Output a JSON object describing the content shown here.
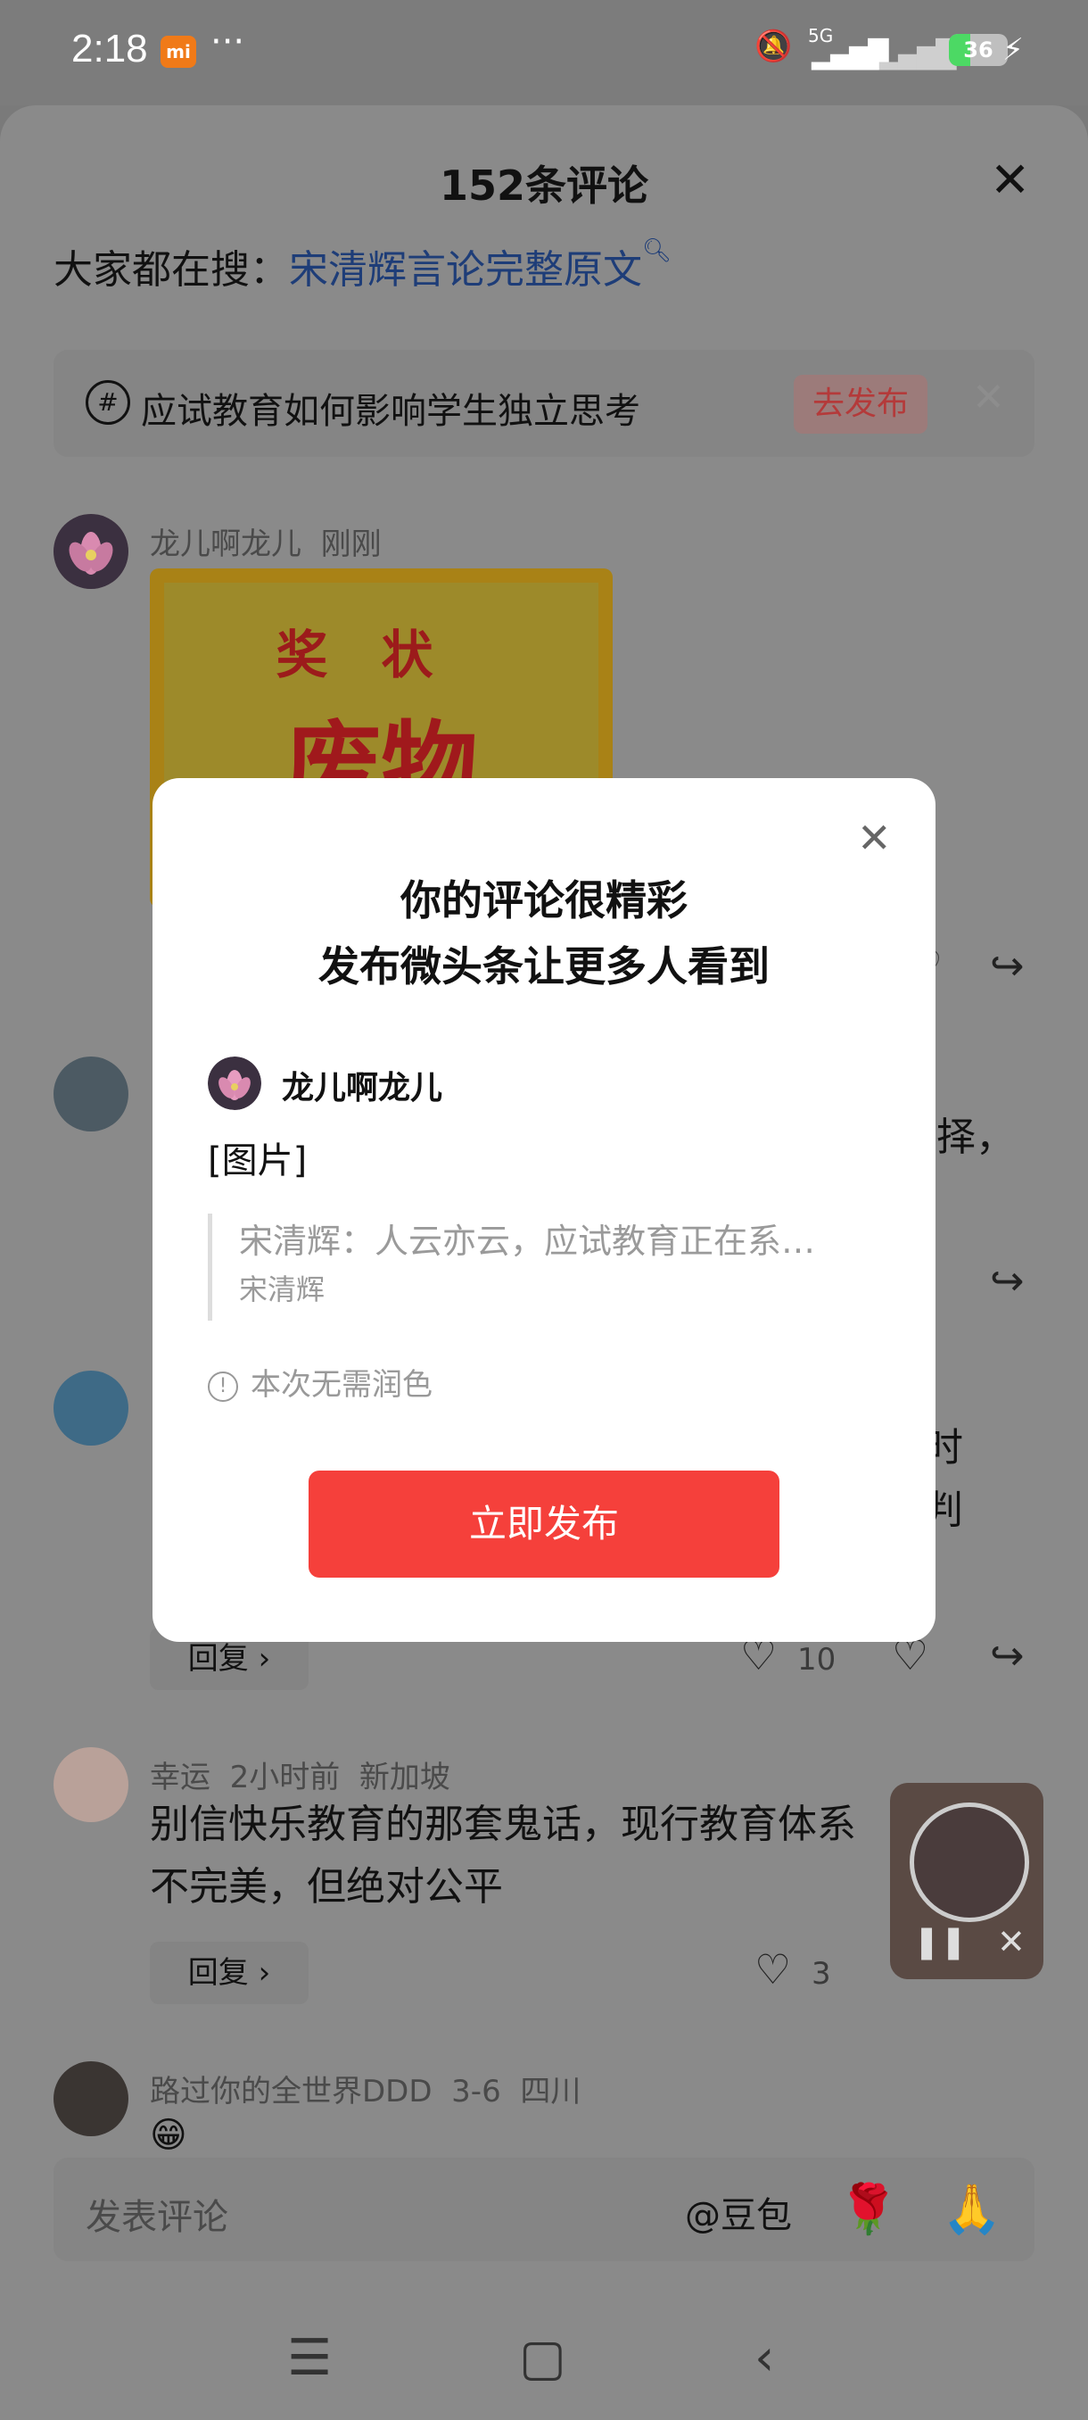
{
  "status_bar": {
    "time": "2:18",
    "mi_badge": "mi",
    "more": "···",
    "battery": "36",
    "battery_level": 0.36,
    "signal": "5G"
  },
  "sheet": {
    "title": "152条评论",
    "close_icon": "close-icon",
    "hot_search_prefix": "大家都在搜：",
    "hot_search_link": "宋清辉言论完整原文",
    "topic": {
      "text": "应试教育如何影响学生独立思考",
      "button": "去发布"
    }
  },
  "comments": [
    {
      "user": "龙儿啊龙儿",
      "time": "刚刚",
      "image_text_1": "奖状",
      "image_text_2": "废物"
    },
    {
      "text_fragment": "择，"
    },
    {
      "text_fragment_1": "时",
      "text_fragment_2": "判",
      "reply": "回复",
      "likes": "10"
    },
    {
      "user": "幸运",
      "time": "2小时前",
      "location": "新加坡",
      "line1": "别信快乐教育的那套鬼话，现行教育体系",
      "line2": "不完美，但绝对公平",
      "reply": "回复",
      "likes": "3"
    },
    {
      "user": "路过你的全世界DDD",
      "time": "3-6",
      "location": "四川",
      "emoji": "😁"
    }
  ],
  "modal": {
    "title_line1": "你的评论很精彩",
    "title_line2": "发布微头条让更多人看到",
    "username": "龙儿啊龙儿",
    "body": "[图片]",
    "quote_text": "宋清辉：人云亦云，应试教育正在系…",
    "quote_author": "宋清辉",
    "note": "本次无需润色",
    "publish_button": "立即发布"
  },
  "bottom": {
    "placeholder": "发表评论",
    "at_label": "@豆包",
    "emoji1": "🌹",
    "emoji2": "🙏"
  }
}
